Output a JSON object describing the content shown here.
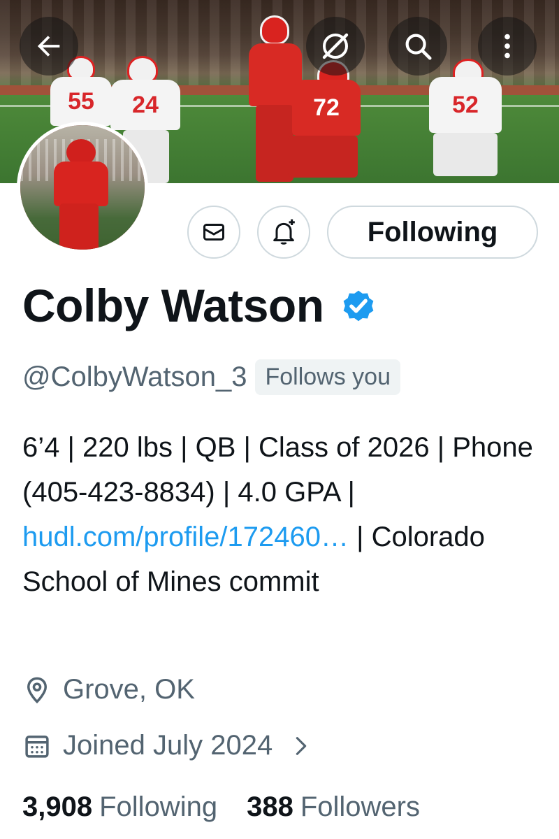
{
  "header": {
    "back_icon": "arrow-left-icon",
    "grok_icon": "grok-icon",
    "search_icon": "search-icon",
    "more_icon": "more-vertical-icon"
  },
  "banner": {
    "jersey_numbers": [
      "55",
      "24",
      "72",
      "52"
    ]
  },
  "actions": {
    "message_icon": "envelope-icon",
    "notify_icon": "bell-plus-icon",
    "following_label": "Following"
  },
  "profile": {
    "display_name": "Colby Watson",
    "verified_icon": "verified-badge-icon",
    "handle": "@ColbyWatson_3",
    "follows_you": "Follows you",
    "bio_before_link": "6’4 | 220 lbs | QB | Class of 2026 | Phone (405-423-8834) | 4.0 GPA | ",
    "bio_link": "hudl.com/profile/172460…",
    "bio_after_link": " | Colorado School of Mines commit",
    "location": "Grove, OK",
    "joined": "Joined July 2024",
    "following_count": "3,908",
    "following_label": "Following",
    "followers_count": "388",
    "followers_label": "Followers"
  },
  "colors": {
    "accent": "#1d9bf0",
    "secondary_text": "#536471",
    "primary_text": "#0f1419",
    "border": "#cfd9de"
  }
}
